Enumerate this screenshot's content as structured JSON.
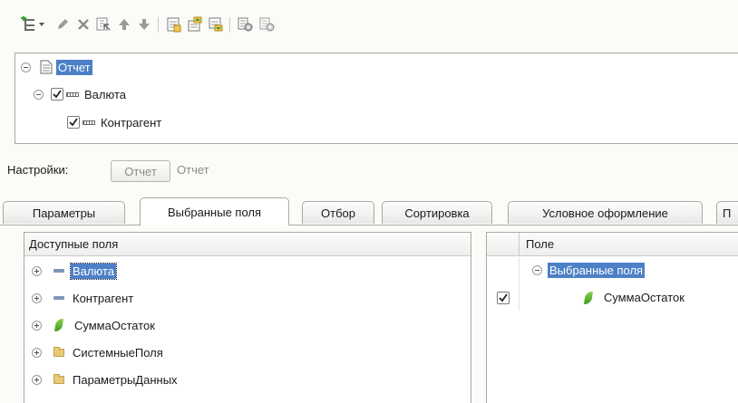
{
  "toolbar": {
    "buttons": [
      {
        "name": "add-grouping-button",
        "icon": "add-hierarchy-icon"
      },
      {
        "name": "add-dropdown-button",
        "icon": "chevron-down-icon"
      },
      {
        "name": "edit-button",
        "icon": "pencil-icon"
      },
      {
        "name": "delete-button",
        "icon": "delete-x-icon"
      },
      {
        "name": "select-button",
        "icon": "select-arrow-icon"
      },
      {
        "name": "move-up-button",
        "icon": "arrow-up-icon"
      },
      {
        "name": "move-down-button",
        "icon": "arrow-down-icon"
      },
      {
        "name": "group-button",
        "icon": "group-icon"
      },
      {
        "name": "move-level-up-button",
        "icon": "level-up-icon"
      },
      {
        "name": "move-level-down-button",
        "icon": "level-down-icon"
      },
      {
        "name": "settings-button",
        "icon": "gear-settings-icon"
      },
      {
        "name": "settings-alt-button",
        "icon": "gear-settings-alt-icon"
      }
    ]
  },
  "structure_tree": {
    "root_label": "Отчет",
    "items": [
      {
        "label": "Валюта",
        "checked": true
      },
      {
        "label": "Контрагент",
        "checked": true
      }
    ]
  },
  "settings": {
    "label": "Настройки:",
    "option_button": "Отчет",
    "option_text": "Отчет"
  },
  "tabs": [
    {
      "label": "Параметры",
      "active": false
    },
    {
      "label": "Выбранные поля",
      "active": true
    },
    {
      "label": "Отбор",
      "active": false
    },
    {
      "label": "Сортировка",
      "active": false
    },
    {
      "label": "Условное оформление",
      "active": false
    },
    {
      "label": "П",
      "active": false
    }
  ],
  "available_fields": {
    "header": "Доступные поля",
    "items": [
      {
        "label": "Валюта",
        "icon": "field-dash-icon",
        "selected": true
      },
      {
        "label": "Контрагент",
        "icon": "field-dash-icon",
        "selected": false
      },
      {
        "label": "СуммаОстаток",
        "icon": "resource-leaf-icon",
        "selected": false
      },
      {
        "label": "СистемныеПоля",
        "icon": "folder-icon",
        "selected": false
      },
      {
        "label": "ПараметрыДанных",
        "icon": "folder-icon",
        "selected": false
      }
    ]
  },
  "selected_fields": {
    "header": "Поле",
    "group_label": "Выбранные поля",
    "items": [
      {
        "label": "СуммаОстаток",
        "checked": true,
        "icon": "resource-leaf-icon"
      }
    ]
  },
  "colors": {
    "selection": "#4d80c6",
    "background": "#fbfbf7",
    "border": "#a9a9a9"
  }
}
